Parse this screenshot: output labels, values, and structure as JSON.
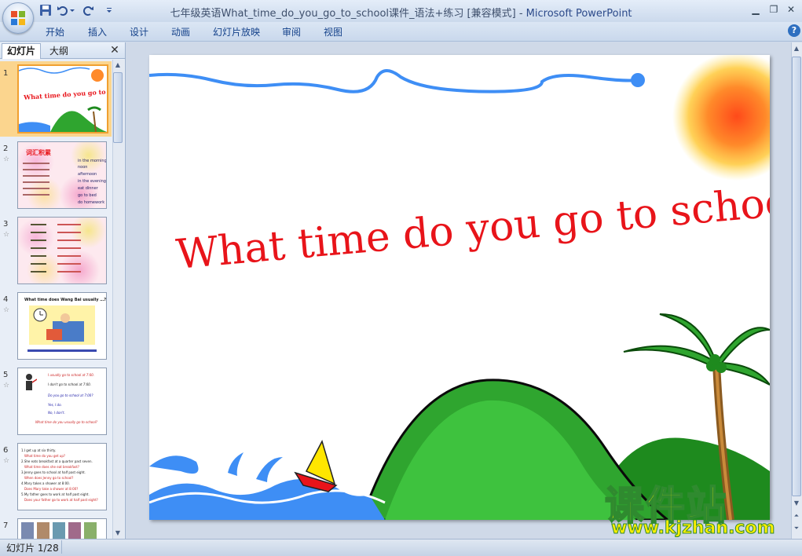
{
  "window": {
    "title": "七年级英语What_time_do_you_go_to_school课件_语法+练习 [兼容模式]",
    "app_name": "Microsoft PowerPoint",
    "separator": " - "
  },
  "ribbon": {
    "tabs": [
      "开始",
      "插入",
      "设计",
      "动画",
      "幻灯片放映",
      "审阅",
      "视图"
    ]
  },
  "panel": {
    "tab_slides": "幻灯片",
    "tab_outline": "大纲",
    "close": "✕",
    "thumbs": [
      {
        "num": "1",
        "title": "What time do you go to school?"
      },
      {
        "num": "2",
        "heading": "词汇积累",
        "right_words": [
          "in the morning",
          "noon",
          "afternoon",
          "in the evening",
          "eat dinner",
          "go to bed",
          "do homework"
        ]
      },
      {
        "num": "3"
      },
      {
        "num": "4",
        "title": "What time does Wang Bai usually …?"
      },
      {
        "num": "5",
        "lines": [
          "I usually go to school at 7:00.",
          "I don't go to school at 7:00.",
          "Do you go to school at 7:00?",
          "Yes, I do.",
          "No, I don't.",
          "What time do you usually go to school?"
        ]
      },
      {
        "num": "6",
        "lines": [
          "1.I get up at six thirty.",
          "What time do you get up?",
          "2.She eats breakfast at a quarter past seven.",
          "What time does she eat breakfast?",
          "3.Jenny goes to school at half past eight.",
          "When does Jenny go to school?",
          "4.Mary takes a shower at 8:00.",
          "Does Mary take a shower at 8:00?",
          "5.My father goes to work at half past eight.",
          "Does your father go to work at half past eight?"
        ]
      },
      {
        "num": "7"
      }
    ]
  },
  "slide": {
    "title": "What time do you go to school?"
  },
  "status": {
    "slide_indicator": "幻灯片 1/28"
  },
  "watermark": {
    "chinese": "课件站",
    "url": "www.kjzhan.com"
  },
  "colors": {
    "title_red": "#e8141a",
    "hill_green": "#2fa52f",
    "wave_blue": "#3e8ef5",
    "sun_orange": "#ff6a1a",
    "watermark_yellow": "#ffef00"
  }
}
